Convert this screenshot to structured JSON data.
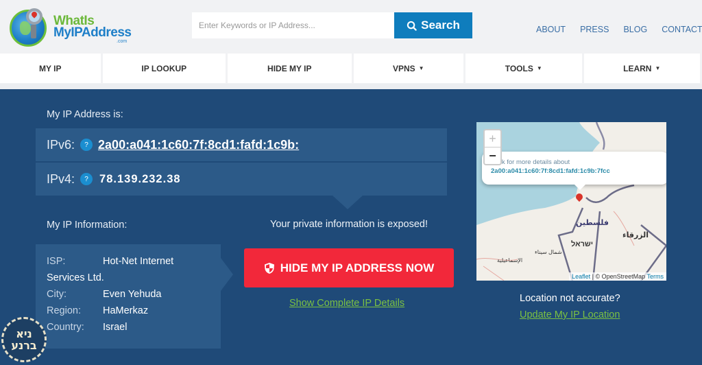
{
  "header": {
    "logo": {
      "line1": "WhatIs",
      "line2": "MyIPAddress",
      "suffix": ".com"
    },
    "search": {
      "placeholder": "Enter Keywords or IP Address...",
      "button_label": "Search"
    },
    "top_links": [
      "ABOUT",
      "PRESS",
      "BLOG",
      "CONTACT"
    ]
  },
  "nav": {
    "items": [
      {
        "label": "MY IP",
        "dropdown": false
      },
      {
        "label": "IP LOOKUP",
        "dropdown": false
      },
      {
        "label": "HIDE MY IP",
        "dropdown": false
      },
      {
        "label": "VPNS",
        "dropdown": true
      },
      {
        "label": "TOOLS",
        "dropdown": true
      },
      {
        "label": "LEARN",
        "dropdown": true
      }
    ],
    "caret": "▼"
  },
  "ip_address": {
    "heading": "My IP Address is:",
    "ipv6_label": "IPv6:",
    "ipv6_value": "2a00:a041:1c60:7f:8cd1:fafd:1c9b:",
    "ipv4_label": "IPv4:",
    "ipv4_value": "78.139.232.38",
    "help_glyph": "?"
  },
  "ip_info": {
    "heading": "My IP Information:",
    "isp_label": "ISP:",
    "isp_value_line1": "Hot-Net Internet",
    "isp_value_line2": "Services Ltd.",
    "city_label": "City:",
    "city_value": "Even Yehuda",
    "region_label": "Region:",
    "region_value": "HaMerkaz",
    "country_label": "Country:",
    "country_value": "Israel"
  },
  "cta": {
    "warning": "Your private information is exposed!",
    "hide_button": "HIDE MY IP ADDRESS NOW",
    "details_link": "Show Complete IP Details"
  },
  "map": {
    "zoom_in": "+",
    "zoom_out": "−",
    "popup_line1": "Click for more details about",
    "popup_line2": "2a00:a041:1c60:7f:8cd1:fafd:1c9b:7fcc",
    "labels": {
      "palestine": "فلسطين",
      "israel": "ישראל",
      "zarqa": "الزرقاء",
      "north_sinai": "شمال سيناء",
      "ismailia": "الإسماعيلية"
    },
    "attribution": {
      "leaflet": "Leaflet",
      "osm": "© OpenStreetMap",
      "terms": "Terms"
    }
  },
  "location": {
    "question": "Location not accurate?",
    "update_link": "Update My IP Location"
  },
  "badge": {
    "line1": "ניא",
    "line2": "ברנע"
  },
  "colors": {
    "main_bg": "#1f4a78",
    "panel_bg": "#2c5a88",
    "accent_blue": "#0f7dbd",
    "cta_red": "#f2283a",
    "link_green": "#7bc142"
  }
}
